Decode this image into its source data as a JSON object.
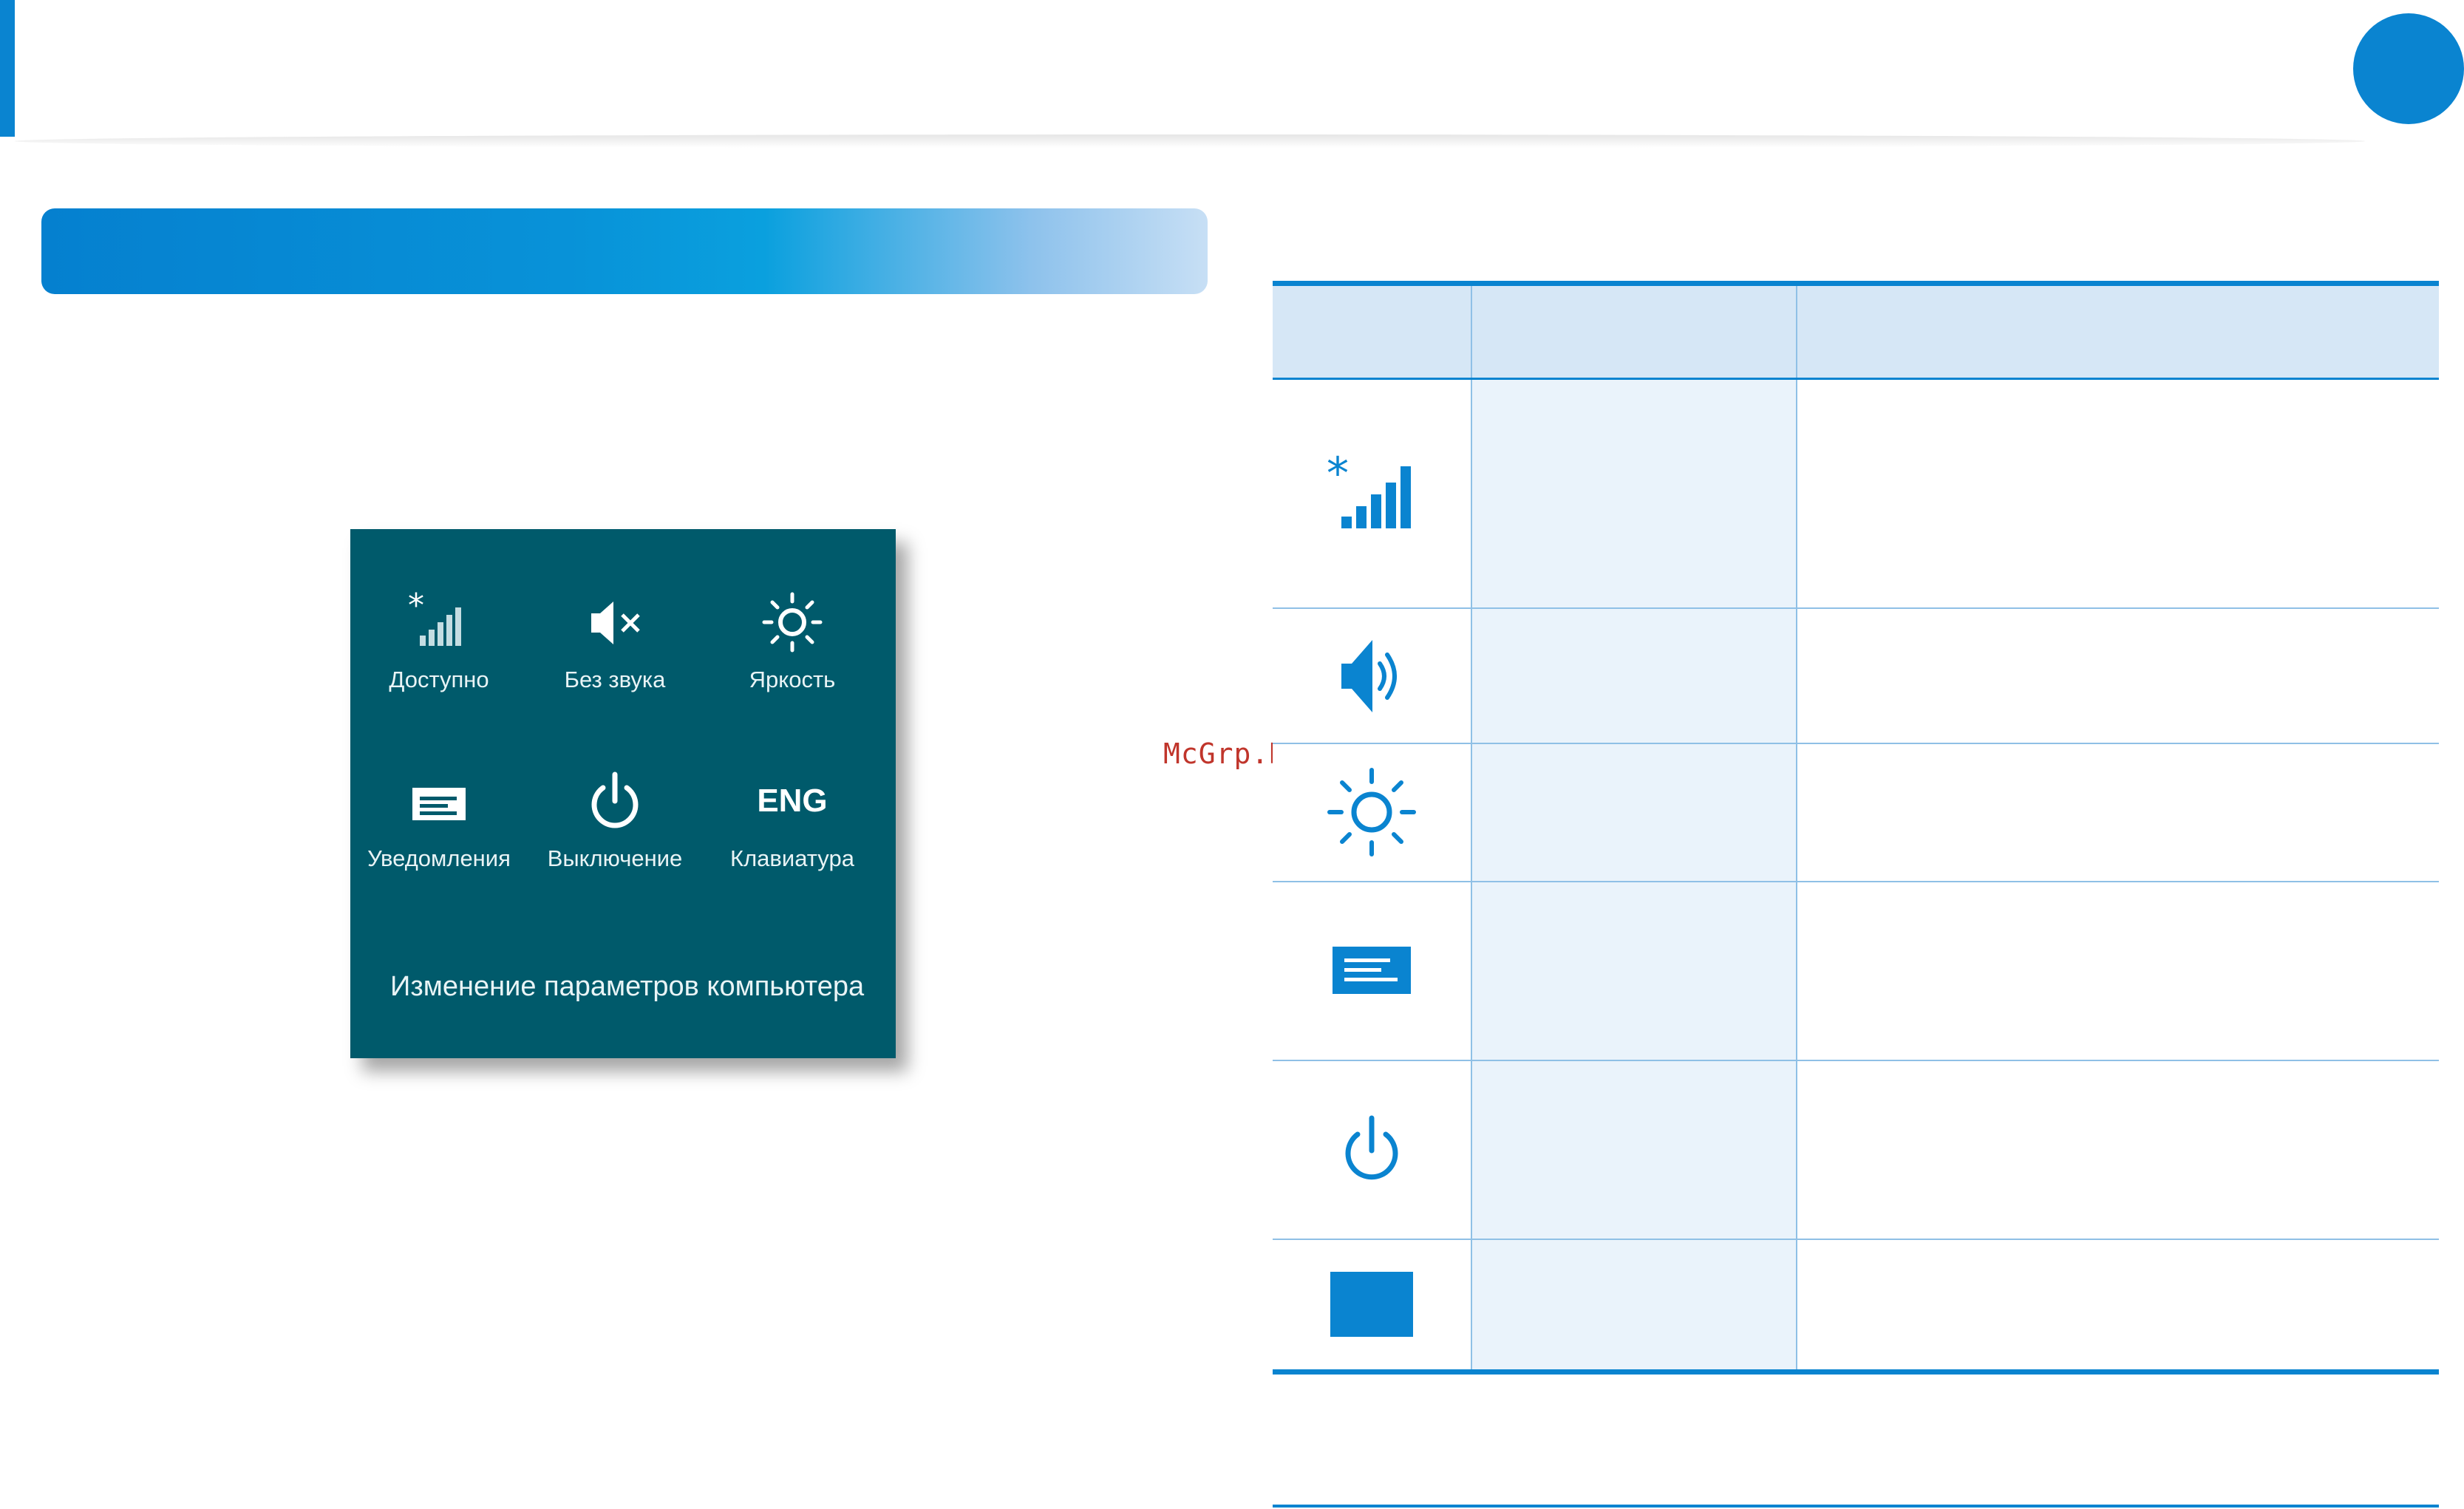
{
  "colors": {
    "accent": "#0a84d0",
    "panel_background": "#005a6b",
    "table_header": "#d6e7f6",
    "table_column_fill": "#eaf3fb",
    "watermark": "#c0352b"
  },
  "settings_panel": {
    "tiles": [
      {
        "icon": "wireless-signal-icon",
        "label": "Доступно"
      },
      {
        "icon": "muted-speaker-icon",
        "label": "Без звука"
      },
      {
        "icon": "brightness-icon",
        "label": "Яркость"
      },
      {
        "icon": "notifications-icon",
        "label": "Уведомления"
      },
      {
        "icon": "power-icon",
        "label": "Выключение"
      },
      {
        "icon": "keyboard-language",
        "label": "Клавиатура",
        "value": "ENG"
      }
    ],
    "pc_settings_link": "Изменение параметров компьютера"
  },
  "watermark": "McGrp.Ru",
  "table": {
    "rows": [
      {
        "icon": "wireless-signal-icon"
      },
      {
        "icon": "speaker-icon"
      },
      {
        "icon": "brightness-icon"
      },
      {
        "icon": "notifications-icon"
      },
      {
        "icon": "power-icon"
      },
      {
        "icon": "keyboard-block-icon"
      }
    ]
  }
}
